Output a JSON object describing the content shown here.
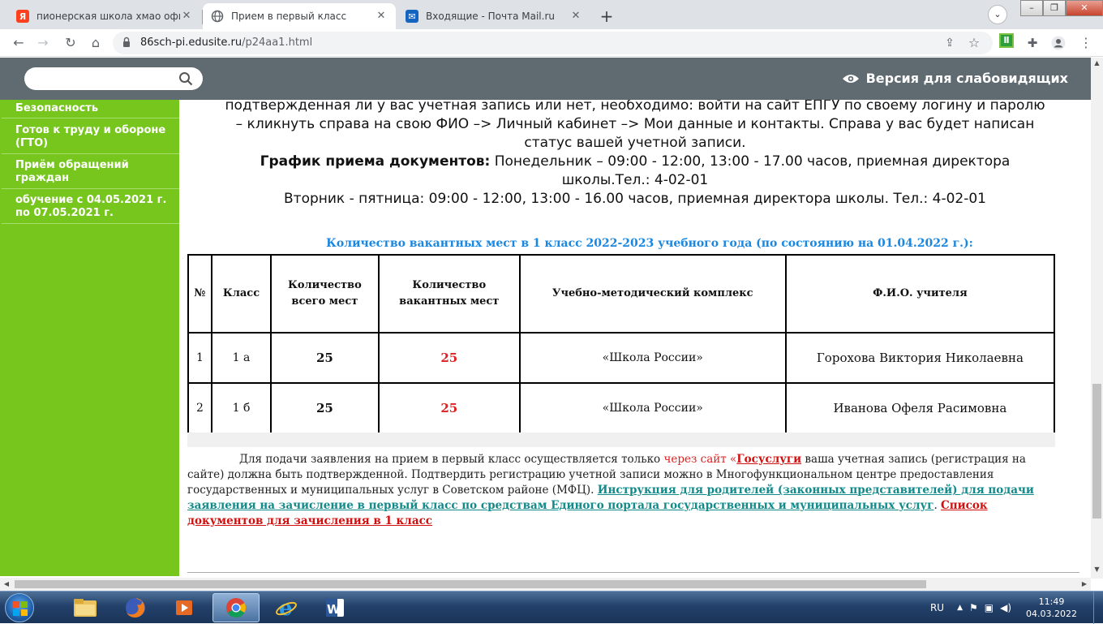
{
  "browser": {
    "tabs": [
      {
        "title": "пионерская школа хмао официальн",
        "icon": "yandex-icon"
      },
      {
        "title": "Прием в первый класс",
        "icon": "globe-icon",
        "active": true
      },
      {
        "title": "Входящие - Почта Mail.ru",
        "icon": "mail-icon"
      }
    ],
    "url_host": "86sch-pi.edusite.ru",
    "url_path": "/p24aa1.html"
  },
  "site": {
    "search_placeholder": "",
    "vision_label": "Версия для слабовидящих",
    "sidenav": [
      "Безопасность",
      "Готов к труду и обороне (ГТО)",
      "Приём обращений граждан",
      "обучение с 04.05.2021 г. по 07.05.2021 г."
    ]
  },
  "content": {
    "intro_line1": "подтвержденная ли у вас учетная запись или нет, необходимо: войти на сайт ЕПГУ по своему логину и паролю",
    "intro_line2": "– кликнуть справа на свою ФИО –> Личный кабинет –> Мои данные и контакты. Справа у вас будет написан",
    "intro_line3": "статус вашей учетной записи.",
    "schedule_label": "График приема документов:",
    "schedule_mon": " Понедельник – 09:00 - 12:00, 13:00 - 17.00 часов, приемная директора",
    "schedule_mon2": "школы.Тел.: 4-02-01",
    "schedule_tue": "Вторник - пятница: 09:00 - 12:00, 13:00 - 16.00 часов, приемная директора школы. Тел.: 4-02-01",
    "vacancy_title": "Количество вакантных мест  в 1 класс 2022-2023 учебного года (по состоянию на 01.04.2022 г.):",
    "table": {
      "headers": [
        "№",
        "Класс",
        "Количество всего мест",
        "Количество вакантных мест",
        "Учебно-методический комплекс",
        "Ф.И.О. учителя"
      ],
      "rows": [
        [
          "1",
          "1 а",
          "25",
          "25",
          "«Школа России»",
          "Горохова Виктория Николаевна"
        ],
        [
          "2",
          "1 б",
          "25",
          "25",
          "«Школа России»",
          "Иванова  Офеля Расимовна"
        ]
      ]
    },
    "notice_part1": "Для подачи заявления на прием в первый класс осуществляется только ",
    "notice_red": "через сайт  «",
    "notice_gosuslugi": "Госуслуги",
    "notice_part2": "  ваша учетная запись (регистрация на сайте) должна быть подтвержденной. Подтвердить регистрацию учетной записи можно в Многофункциональном центре предоставления государственных и муниципальных услуг в Советском районе (МФЦ). ",
    "notice_link_instr": "Инструкция для родителей (законных представителей) для подачи заявления на зачисление в первый класс по средствам Единого портала государственных и муниципальных услуг",
    "notice_dot": ". ",
    "notice_link_docs": "Список документов для зачисления в 1 класс"
  },
  "taskbar": {
    "lang": "RU",
    "time": "11:49",
    "date": "04.03.2022"
  }
}
